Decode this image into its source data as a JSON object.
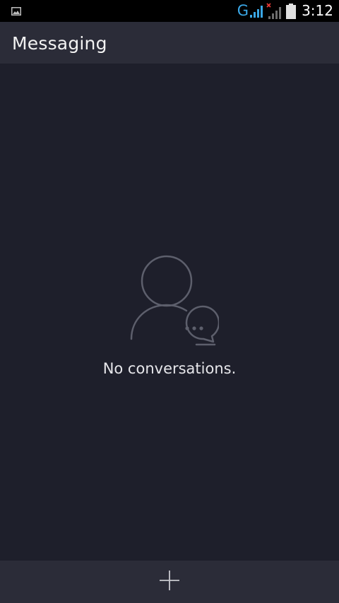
{
  "status_bar": {
    "network_type": "G",
    "time": "3:12",
    "icons": [
      "image-notification-icon",
      "signal-strength-icon",
      "no-signal-icon",
      "battery-icon"
    ]
  },
  "action_bar": {
    "title": "Messaging"
  },
  "empty_state": {
    "icon": "contact-chat-icon",
    "message": "No conversations."
  },
  "bottom_bar": {
    "compose_icon": "plus-icon"
  },
  "colors": {
    "background": "#1e1f2b",
    "bars": "#2b2c38",
    "status_bar": "#000000",
    "accent_blue": "#3aa7e6",
    "text": "#f2f2f2",
    "icon_gray": "#5d5f6c"
  }
}
